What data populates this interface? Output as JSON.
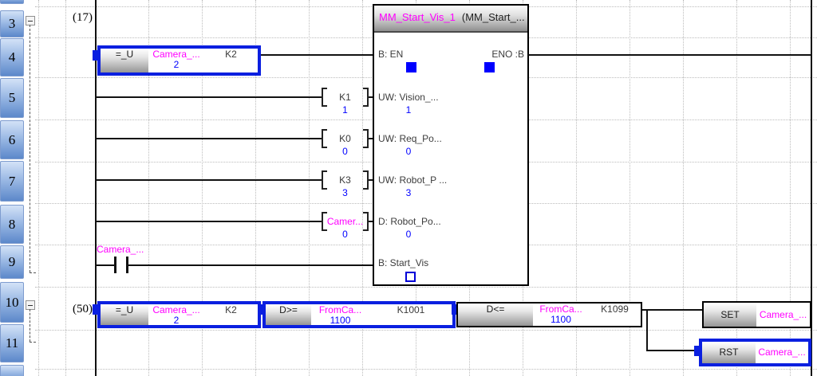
{
  "colors": {
    "selection_blue": "#0a1fe0",
    "operand_magenta": "#ff00ff",
    "value_blue": "#0000ff"
  },
  "gutter": {
    "rows": [
      "3",
      "4",
      "5",
      "6",
      "7",
      "8",
      "9",
      "10",
      "11"
    ]
  },
  "rung_a": {
    "step": "(17)",
    "fb": {
      "instance": "MM_Start_Vis_1",
      "type": "(MM_Start_...",
      "pin_en": "B: EN",
      "pin_eno": "ENO :B",
      "pin_start": "B: Start_Vis",
      "pins": [
        {
          "label": "UW: Vision_...",
          "value": "1"
        },
        {
          "label": "UW: Req_Po...",
          "value": "0"
        },
        {
          "label": "UW: Robot_P ...",
          "value": "3"
        },
        {
          "label": "D: Robot_Po...",
          "value": "0"
        }
      ]
    },
    "cmp": {
      "op": "=_U",
      "arg1": "Camera_...",
      "arg1_value": "2",
      "arg2": "K2"
    },
    "inputs": [
      {
        "operand": "K1",
        "value": "1"
      },
      {
        "operand": "K0",
        "value": "0"
      },
      {
        "operand": "K3",
        "value": "3"
      },
      {
        "operand": "Camer...",
        "value": "0"
      }
    ],
    "contact": {
      "label": "Camera_..."
    }
  },
  "rung_b": {
    "step": "(50)",
    "cmp1": {
      "op": "=_U",
      "arg1": "Camera_...",
      "arg1_value": "2",
      "arg2": "K2"
    },
    "cmp2": {
      "op": "D>=",
      "arg1": "FromCa...",
      "arg1_value": "1100",
      "arg2": "K1001"
    },
    "cmp3": {
      "op": "D<=",
      "arg1": "FromCa...",
      "arg1_value": "1100",
      "arg2": "K1099"
    },
    "set_coil": {
      "op": "SET",
      "arg": "Camera_..."
    },
    "rst_coil": {
      "op": "RST",
      "arg": "Camera_..."
    }
  }
}
